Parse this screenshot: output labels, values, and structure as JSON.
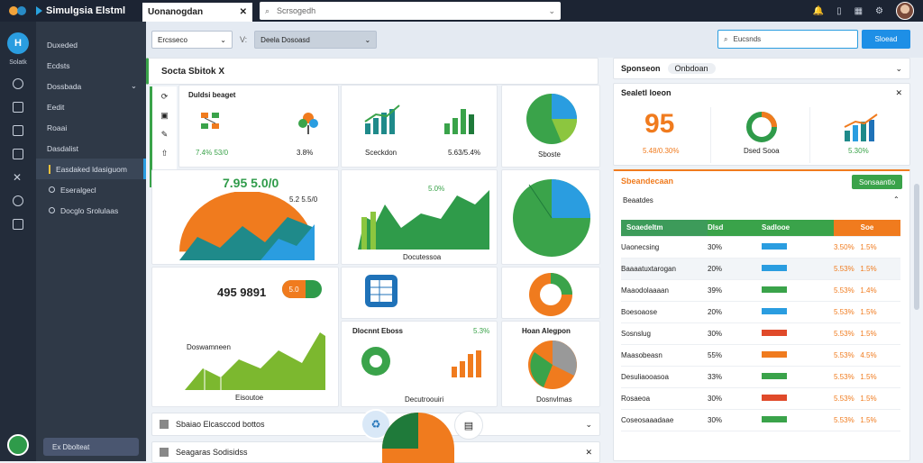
{
  "topbar": {
    "app_title": "Simulgsia Elstml",
    "tab_label": "Uonanogdan",
    "url_placeholder": "Scrsogedh"
  },
  "rail": {
    "home_label": "H",
    "section_label": "Solatk"
  },
  "sidebar": {
    "items": [
      {
        "label": "Duxeded"
      },
      {
        "label": "Ecdsts"
      },
      {
        "label": "Dossbada"
      },
      {
        "label": "Eedit"
      },
      {
        "label": "Roaai"
      },
      {
        "label": "Dasdalist"
      },
      {
        "label": "Easdaked ldasiguom"
      },
      {
        "label": "Eseralgecl"
      },
      {
        "label": "Docglo Srolulaas"
      }
    ],
    "footer_label": "Ex Dbolteat"
  },
  "filters": {
    "select1": "Ercsseco",
    "sep": "V:",
    "select2": "Deela Dosoasd",
    "search_value": "Eucsnds",
    "search_button": "Sloead"
  },
  "grid": {
    "title": "Socta Sbitok X",
    "card1": {
      "title": "Duldsi beaget",
      "v1": "7.4%  53/0",
      "v2": "3.8%"
    },
    "card2": {
      "v1": "Sceckdon",
      "v2": "5.63/5.4%"
    },
    "card3": {
      "label": "Sboste"
    },
    "card4": {
      "headline": "7.95 5.0/0",
      "tag": "5.2 5.5/0"
    },
    "card5": {
      "tag": "5.0%",
      "label": "Docutessoa"
    },
    "card7": {
      "value": "495 9891",
      "badge": "5.0"
    },
    "card8": {
      "tag": "Doswamneen"
    },
    "card10": {
      "label": "Eisoutoe"
    },
    "card11": {
      "title": "Dlocnnt Eboss",
      "tag": "5.3%",
      "label": "Decutroouiri"
    },
    "card12": {
      "title": "Hoan Alegpon",
      "label": "Dosnvlmas"
    }
  },
  "bottom": {
    "row1": "Sbaiao Elcasccod bottos",
    "row2": "Seagaras Sodisidss"
  },
  "right": {
    "dropdown_label": "Sponseon",
    "dropdown_chip": "Onbdoan",
    "kpi_title": "Sealetl loeon",
    "kpi1_big": "95",
    "kpi1_sub": "5.48/0.30%",
    "kpi2_sub": "Dsed Sooa",
    "kpi3_sub": "5.30%",
    "table_title": "Sbeandecaan",
    "table_button": "Sonsaantlo",
    "table_sub": "Beaatdes",
    "header": {
      "c1": "Soaedeltm",
      "c2": "Dlsd",
      "c3": "Sadlooe",
      "c4": "Soe"
    },
    "rows": [
      {
        "name": "Uaonecsing",
        "p": "30%",
        "q": "3.50%",
        "z": "1.5%"
      },
      {
        "name": "Baaaatuxtarogan",
        "p": "20%",
        "q": "5.53%",
        "z": "1.5%"
      },
      {
        "name": "Maaodolaaaan",
        "p": "39%",
        "q": "5.53%",
        "z": "1.4%"
      },
      {
        "name": "Boesoaose",
        "p": "20%",
        "q": "5.53%",
        "z": "1.5%"
      },
      {
        "name": "Sosnslug",
        "p": "30%",
        "q": "5.53%",
        "z": "1.5%"
      },
      {
        "name": "Maasobeasn",
        "p": "55%",
        "q": "5.53%",
        "z": "4.5%"
      },
      {
        "name": "Desuliaooasoa",
        "p": "33%",
        "q": "5.53%",
        "z": "1.5%"
      },
      {
        "name": "Rosaeoa",
        "p": "30%",
        "q": "5.53%",
        "z": "1.5%"
      },
      {
        "name": "Coseosaaadaae",
        "p": "30%",
        "q": "5.53%",
        "z": "1.5%"
      }
    ]
  }
}
